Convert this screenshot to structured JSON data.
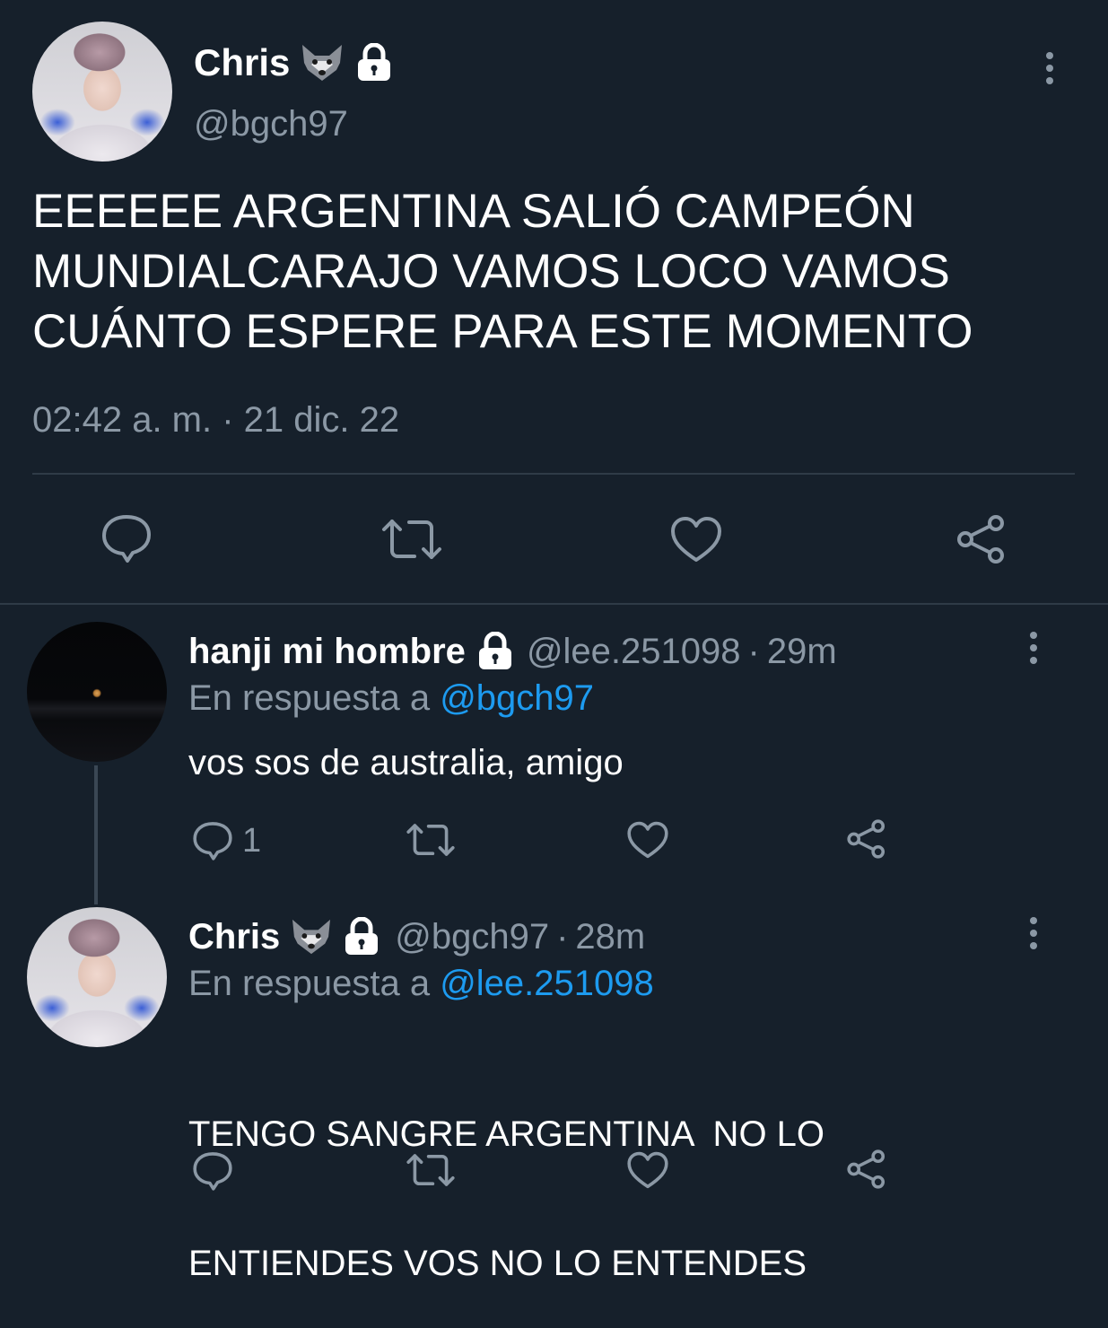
{
  "main_tweet": {
    "display_name": "Chris",
    "handle": "@bgch97",
    "text_lines": [
      "EEEEEE ARGENTINA SALIÓ CAMPEÓN",
      "MUNDIALCARAJO VAMOS LOCO VAMOS",
      "CUÁNTO ESPERE PARA ESTE MOMENTO"
    ],
    "timestamp": "02:42 a. m. · 21 dic. 22",
    "icons": {
      "wolf": "wolf-emoji",
      "lock": "lock-icon",
      "more": "more-vertical-icon"
    },
    "actions": [
      "reply-icon",
      "retweet-icon",
      "like-icon",
      "share-icon"
    ]
  },
  "replies": [
    {
      "display_name": "hanji mi hombre",
      "handle": "@lee.251098",
      "time": "29m",
      "reply_prefix": "En respuesta a",
      "reply_to": "@bgch97",
      "text_lines": [
        "vos sos de australia, amigo"
      ],
      "reply_count": "1"
    },
    {
      "display_name": "Chris",
      "handle": "@bgch97",
      "time": "28m",
      "reply_prefix": "En respuesta a",
      "reply_to": "@lee.251098",
      "text_lines": [
        "TENGO SANGRE ARGENTINA  NO LO",
        "ENTIENDES VOS NO LO ENTENDES"
      ],
      "reply_count": ""
    }
  ],
  "colors": {
    "background": "#16202b",
    "text": "#ffffff",
    "muted": "#8b98a5",
    "link": "#1d9bf0",
    "divider": "#2f3b47"
  }
}
